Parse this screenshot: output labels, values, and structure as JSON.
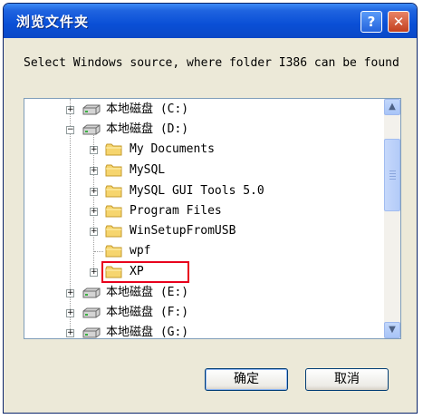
{
  "window": {
    "title": "浏览文件夹",
    "help_label": "?",
    "close_label": "✕"
  },
  "instruction": "Select Windows source, where folder I386 can be found",
  "tree": [
    {
      "label": "本地磁盘 (C:)",
      "icon": "drive-icon",
      "expander": "+"
    },
    {
      "label": "本地磁盘 (D:)",
      "icon": "drive-icon",
      "expander": "−"
    },
    {
      "label": "My Documents",
      "icon": "folder-icon",
      "expander": "+"
    },
    {
      "label": "MySQL",
      "icon": "folder-icon",
      "expander": "+"
    },
    {
      "label": "MySQL GUI Tools 5.0",
      "icon": "folder-icon",
      "expander": "+"
    },
    {
      "label": "Program Files",
      "icon": "folder-icon",
      "expander": "+"
    },
    {
      "label": "WinSetupFromUSB",
      "icon": "folder-icon",
      "expander": "+"
    },
    {
      "label": "wpf",
      "icon": "folder-icon",
      "expander": ""
    },
    {
      "label": "XP",
      "icon": "folder-icon",
      "expander": "+"
    },
    {
      "label": "本地磁盘 (E:)",
      "icon": "drive-icon",
      "expander": "+"
    },
    {
      "label": "本地磁盘 (F:)",
      "icon": "drive-icon",
      "expander": "+"
    },
    {
      "label": "本地磁盘 (G:)",
      "icon": "drive-icon",
      "expander": "+"
    }
  ],
  "scrollbar": {
    "up_arrow": "▲",
    "down_arrow": "▼"
  },
  "buttons": {
    "ok_label": "确定",
    "cancel_label": "取消"
  },
  "colors": {
    "titlebar": "#0a4fd6",
    "highlight_box": "#e8001c",
    "folder": "#f6d56e"
  }
}
